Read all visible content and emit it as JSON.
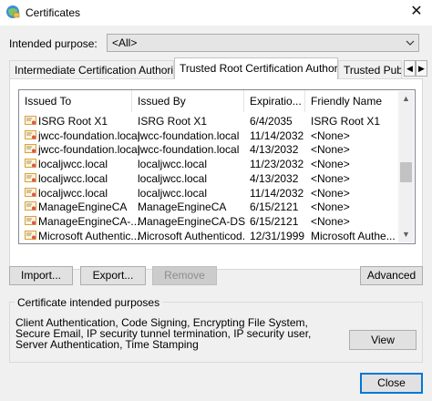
{
  "window": {
    "title": "Certificates",
    "close_glyph": "✕"
  },
  "intended_purpose": {
    "label": "Intended purpose:",
    "value": "<All>"
  },
  "tabs": [
    {
      "label": "Intermediate Certification Authorities"
    },
    {
      "label": "Trusted Root Certification Authorities"
    },
    {
      "label": "Trusted Publi"
    }
  ],
  "columns": [
    "Issued To",
    "Issued By",
    "Expiratio...",
    "Friendly Name"
  ],
  "rows": [
    {
      "issued_to": "ISRG Root X1",
      "issued_by": "ISRG Root X1",
      "expiration": "6/4/2035",
      "friendly": "ISRG Root X1"
    },
    {
      "issued_to": "jwcc-foundation.local",
      "issued_by": "jwcc-foundation.local",
      "expiration": "11/14/2032",
      "friendly": "<None>"
    },
    {
      "issued_to": "jwcc-foundation.local",
      "issued_by": "jwcc-foundation.local",
      "expiration": "4/13/2032",
      "friendly": "<None>"
    },
    {
      "issued_to": "localjwcc.local",
      "issued_by": "localjwcc.local",
      "expiration": "11/23/2032",
      "friendly": "<None>"
    },
    {
      "issued_to": "localjwcc.local",
      "issued_by": "localjwcc.local",
      "expiration": "4/13/2032",
      "friendly": "<None>"
    },
    {
      "issued_to": "localjwcc.local",
      "issued_by": "localjwcc.local",
      "expiration": "11/14/2032",
      "friendly": "<None>"
    },
    {
      "issued_to": "ManageEngineCA",
      "issued_by": "ManageEngineCA",
      "expiration": "6/15/2121",
      "friendly": "<None>"
    },
    {
      "issued_to": "ManageEngineCA-...",
      "issued_by": "ManageEngineCA-DS-...",
      "expiration": "6/15/2121",
      "friendly": "<None>"
    },
    {
      "issued_to": "Microsoft Authentic...",
      "issued_by": "Microsoft Authenticod...",
      "expiration": "12/31/1999",
      "friendly": "Microsoft Authe..."
    }
  ],
  "buttons": {
    "import": "Import...",
    "export": "Export...",
    "remove": "Remove",
    "advanced": "Advanced",
    "view": "View",
    "close": "Close"
  },
  "purposes_group": {
    "label": "Certificate intended purposes",
    "text": "Client Authentication, Code Signing, Encrypting File System, Secure Email, IP security tunnel termination, IP security user, Server Authentication, Time Stamping"
  },
  "colors": {
    "accent": "#0078d7",
    "cert_icon": "#d9a13b"
  }
}
